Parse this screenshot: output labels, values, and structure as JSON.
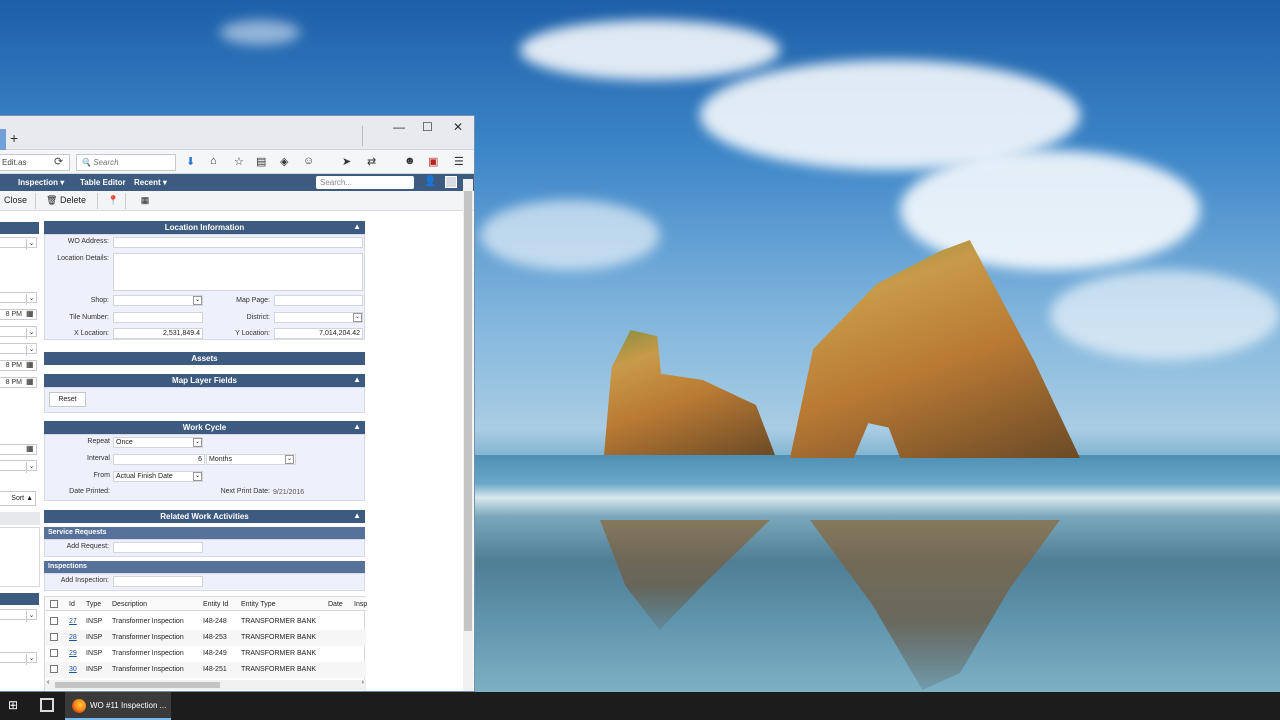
{
  "browser": {
    "new_tab": "+",
    "minimize": "—",
    "maximize": "☐",
    "close": "✕",
    "url_fragment": "Edit.as",
    "search_placeholder": "Search"
  },
  "app_menu": {
    "inspection": "Inspection ▾",
    "table_editor": "Table Editor",
    "recent": "Recent ▾",
    "search_placeholder": "Search..."
  },
  "toolbar": {
    "close_label": "Close",
    "delete_label": "Delete"
  },
  "left_column": {
    "times": [
      "8 PM",
      "8 PM",
      "8 PM"
    ],
    "sort_label": "Sort ▲"
  },
  "location_information": {
    "header": "Location Information",
    "wo_address_label": "WO Address:",
    "location_details_label": "Location Details:",
    "shop_label": "Shop:",
    "map_page_label": "Map Page:",
    "tile_number_label": "Tile Number:",
    "district_label": "District:",
    "x_location_label": "X Location:",
    "x_location_value": "2,531,849.4",
    "y_location_label": "Y Location:",
    "y_location_value": "7,014,204.42"
  },
  "assets": {
    "header": "Assets"
  },
  "map_layer_fields": {
    "header": "Map Layer Fields",
    "reset_label": "Reset"
  },
  "work_cycle": {
    "header": "Work Cycle",
    "repeat_label": "Repeat",
    "repeat_value": "Once",
    "interval_label": "Interval",
    "interval_value": "6",
    "interval_unit": "Months",
    "from_label": "From",
    "from_value": "Actual Finish Date",
    "date_printed_label": "Date Printed:",
    "next_print_label": "Next Print Date:",
    "next_print_value": "9/21/2016"
  },
  "related_work": {
    "header": "Related Work Activities",
    "service_requests": "Service Requests",
    "add_request_label": "Add Request:",
    "inspections": "Inspections",
    "add_inspection_label": "Add Inspection:"
  },
  "inspection_table": {
    "columns": [
      "Id",
      "Type",
      "Description",
      "Entity Id",
      "Entity Type",
      "Date",
      "Insp"
    ],
    "rows": [
      {
        "id": "27",
        "type": "INSP",
        "description": "Transformer Inspection",
        "entity_id": "I48-248",
        "entity_type": "TRANSFORMER BANK"
      },
      {
        "id": "28",
        "type": "INSP",
        "description": "Transformer Inspection",
        "entity_id": "I48-253",
        "entity_type": "TRANSFORMER BANK"
      },
      {
        "id": "29",
        "type": "INSP",
        "description": "Transformer Inspection",
        "entity_id": "I48-249",
        "entity_type": "TRANSFORMER BANK"
      },
      {
        "id": "30",
        "type": "INSP",
        "description": "Transformer Inspection",
        "entity_id": "I48-251",
        "entity_type": "TRANSFORMER BANK"
      }
    ]
  },
  "taskbar": {
    "firefox_task": "WO #11 Inspection ..."
  }
}
